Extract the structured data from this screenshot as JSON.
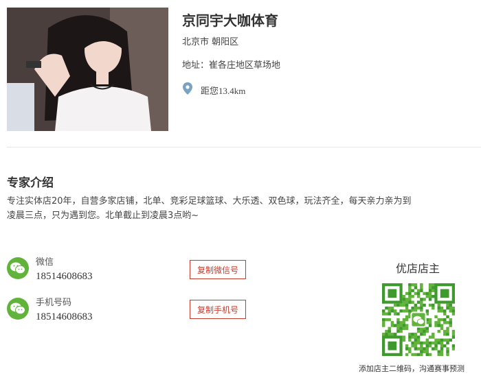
{
  "shop": {
    "name": "京同宇大咖体育",
    "region": "北京市 朝阳区",
    "address": "地址：崔各庄地区草场地",
    "distance": "距您13.4km"
  },
  "intro": {
    "title": "专家介绍",
    "text": "专注实体店20年，自营多家店铺，北单、竞彩足球篮球、大乐透、双色球，玩法齐全，每天亲力亲为到凌晨三点，只为遇到您。北单截止到凌晨3点哟~"
  },
  "contacts": [
    {
      "label": "微信",
      "value": "18514608683",
      "button": "复制微信号"
    },
    {
      "label": "手机号码",
      "value": "18514608683",
      "button": "复制手机号"
    }
  ],
  "owner": {
    "title": "优店店主",
    "qr_caption": "添加店主二维码，沟通赛事预测"
  },
  "colors": {
    "accent_green": "#62b33c",
    "button_red": "#c83a2c",
    "pin_blue": "#7aa2c2"
  }
}
